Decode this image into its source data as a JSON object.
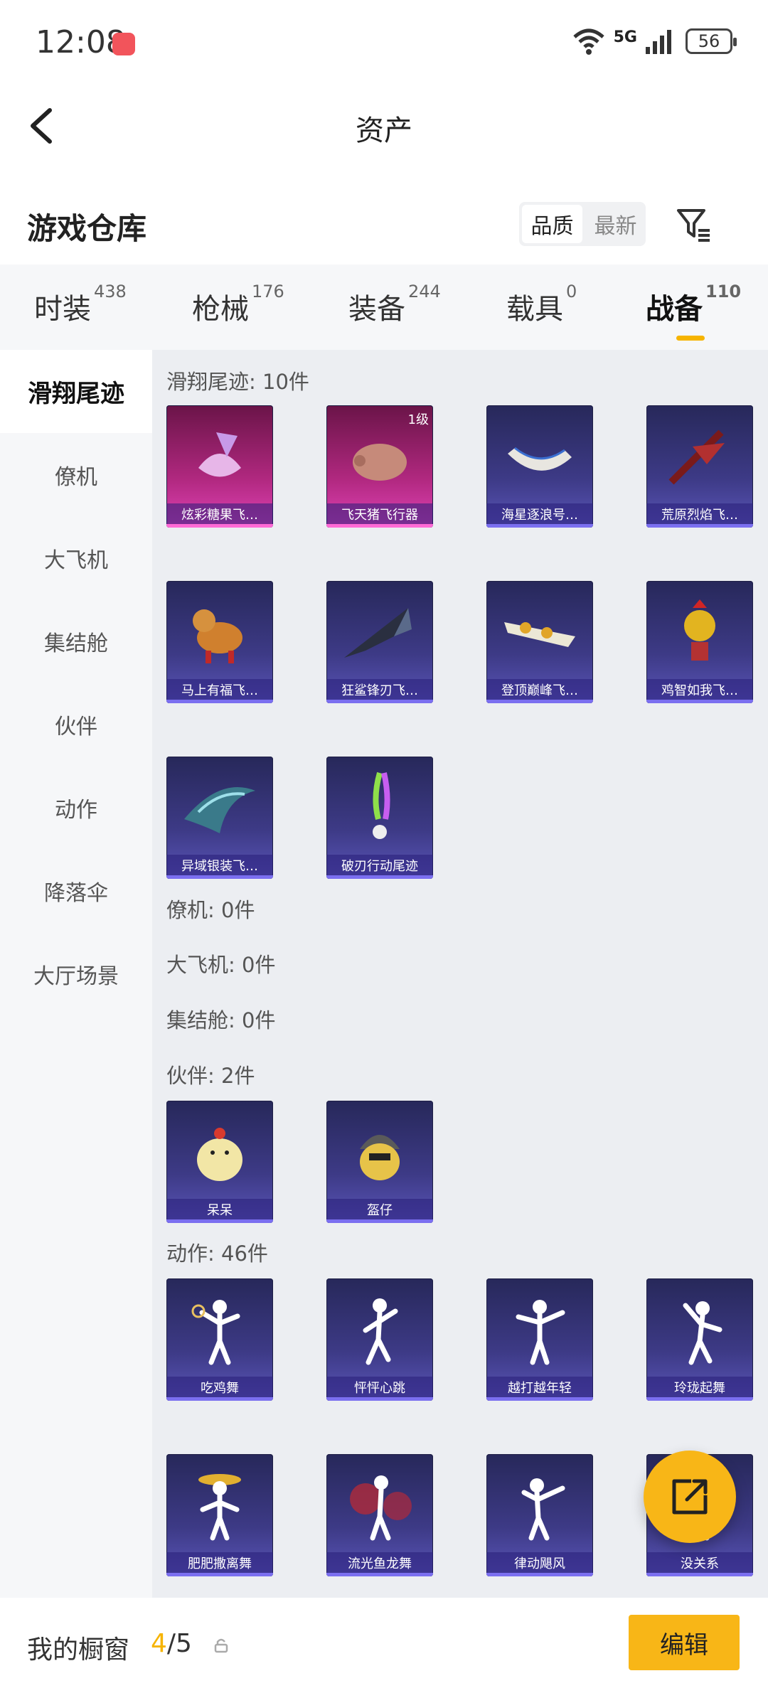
{
  "status": {
    "time": "12:08",
    "network": "5G",
    "battery": "56"
  },
  "nav": {
    "title": "资产"
  },
  "warehouse": {
    "title": "游戏仓库",
    "sort_quality": "品质",
    "sort_latest": "最新"
  },
  "tabs": [
    {
      "label": "时装",
      "count": "438"
    },
    {
      "label": "枪械",
      "count": "176"
    },
    {
      "label": "装备",
      "count": "244"
    },
    {
      "label": "载具",
      "count": "0"
    },
    {
      "label": "战备",
      "count": "110"
    }
  ],
  "sidebar": [
    "滑翔尾迹",
    "僚机",
    "大飞机",
    "集结舱",
    "伙伴",
    "动作",
    "降落伞",
    "大厅场景"
  ],
  "sections": {
    "glide": {
      "title": "滑翔尾迹: 10件",
      "items": [
        "炫彩糖果飞…",
        "飞天猪飞行器",
        "海星逐浪号…",
        "荒原烈焰飞…",
        "马上有福飞…",
        "狂鲨锋刃飞…",
        "登顶巅峰飞…",
        "鸡智如我飞…",
        "异域银装飞…",
        "破刃行动尾迹"
      ],
      "level_badge": "1级"
    },
    "wingman": {
      "title": "僚机: 0件"
    },
    "plane": {
      "title": "大飞机: 0件"
    },
    "pod": {
      "title": "集结舱: 0件"
    },
    "partner": {
      "title": "伙伴: 2件",
      "items": [
        "呆呆",
        "盔仔"
      ]
    },
    "emote": {
      "title": "动作: 46件",
      "items": [
        "吃鸡舞",
        "怦怦心跳",
        "越打越年轻",
        "玲珑起舞",
        "肥肥撒离舞",
        "流光鱼龙舞",
        "律动飓风",
        "没关系"
      ]
    }
  },
  "bottom": {
    "label": "我的橱窗",
    "count_current": "4",
    "count_total": "/5",
    "edit": "编辑"
  }
}
